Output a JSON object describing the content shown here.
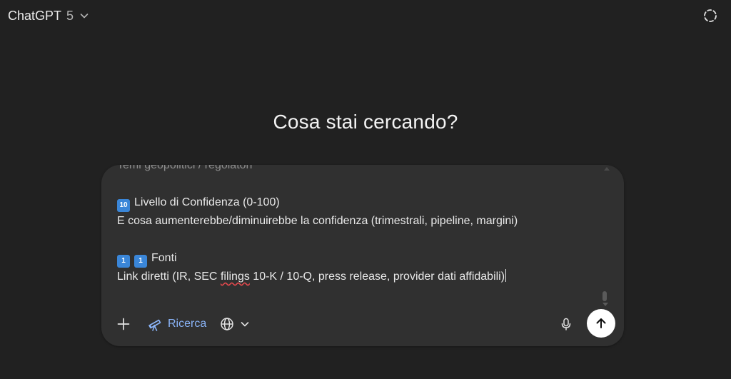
{
  "header": {
    "model_name": "ChatGPT",
    "model_version": "5",
    "model_chevron_icon": "chevron-down-icon",
    "temporary_chat_icon": "dashed-circle-icon"
  },
  "main": {
    "headline": "Cosa stai cercando?"
  },
  "composer": {
    "lines": {
      "l0": "Temi geopolitici / regolatori",
      "l1_badge": "10",
      "l1_text": "Livello di Confidenza (0-100)",
      "l2": "E cosa aumenterebbe/diminuirebbe la confidenza (trimestrali, pipeline, margini)",
      "l3_badge_a": "1",
      "l3_badge_b": "1",
      "l3_text": "Fonti",
      "l4_pre": "Link diretti (IR, SEC ",
      "l4_misspelled": "filings",
      "l4_post": " 10-K / 10-Q, press release, provider dati affidabili)"
    },
    "toolbar": {
      "research_label": "Ricerca",
      "accent_color": "#8ab4f8"
    }
  },
  "colors": {
    "background": "#212121",
    "composer": "#303030",
    "badge": "#3a86d8"
  }
}
